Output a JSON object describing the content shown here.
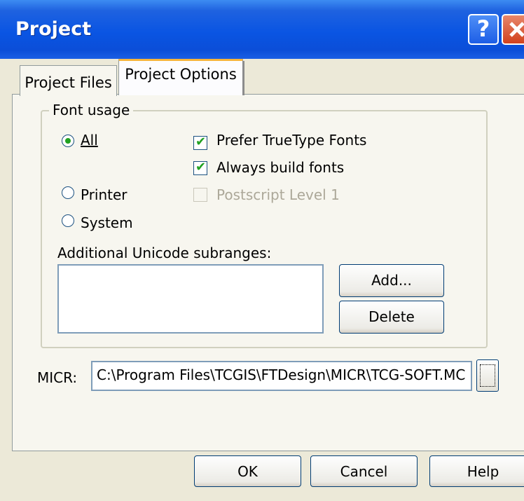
{
  "window": {
    "title": "Project",
    "help_glyph": "?",
    "close_icon": "close-icon"
  },
  "tabs": [
    {
      "label": "Project Files",
      "active": false
    },
    {
      "label": "Project Options",
      "active": true
    }
  ],
  "font_usage": {
    "group_label": "Font usage",
    "radios": [
      {
        "label": "All",
        "checked": true
      },
      {
        "label": "Printer",
        "checked": false
      },
      {
        "label": "System",
        "checked": false
      }
    ],
    "checkboxes": [
      {
        "label": "Prefer TrueType Fonts",
        "checked": true,
        "enabled": true
      },
      {
        "label": "Always build fonts",
        "checked": true,
        "enabled": true
      },
      {
        "label": "Postscript Level 1",
        "checked": false,
        "enabled": false
      }
    ],
    "unicode_label": "Additional Unicode subranges:",
    "unicode_items": [],
    "add_label": "Add...",
    "delete_label": "Delete"
  },
  "micr": {
    "label": "MICR:",
    "value": "C:\\Program Files\\TCGIS\\FTDesign\\MICR\\TCG-SOFT.MC",
    "browse_label": "..."
  },
  "footer": {
    "ok": "OK",
    "cancel": "Cancel",
    "help": "Help"
  },
  "colors": {
    "titlebar": "#0a55e3",
    "background": "#ece9d8",
    "active_tab_highlight": "#f8b53a"
  }
}
